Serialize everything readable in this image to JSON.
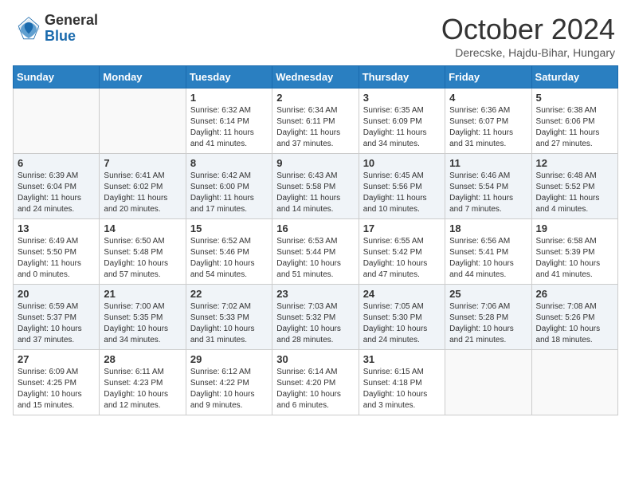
{
  "logo": {
    "general": "General",
    "blue": "Blue"
  },
  "header": {
    "month": "October 2024",
    "location": "Derecske, Hajdu-Bihar, Hungary"
  },
  "weekdays": [
    "Sunday",
    "Monday",
    "Tuesday",
    "Wednesday",
    "Thursday",
    "Friday",
    "Saturday"
  ],
  "weeks": [
    [
      {
        "day": "",
        "sunrise": "",
        "sunset": "",
        "daylight": ""
      },
      {
        "day": "",
        "sunrise": "",
        "sunset": "",
        "daylight": ""
      },
      {
        "day": "1",
        "sunrise": "Sunrise: 6:32 AM",
        "sunset": "Sunset: 6:14 PM",
        "daylight": "Daylight: 11 hours and 41 minutes."
      },
      {
        "day": "2",
        "sunrise": "Sunrise: 6:34 AM",
        "sunset": "Sunset: 6:11 PM",
        "daylight": "Daylight: 11 hours and 37 minutes."
      },
      {
        "day": "3",
        "sunrise": "Sunrise: 6:35 AM",
        "sunset": "Sunset: 6:09 PM",
        "daylight": "Daylight: 11 hours and 34 minutes."
      },
      {
        "day": "4",
        "sunrise": "Sunrise: 6:36 AM",
        "sunset": "Sunset: 6:07 PM",
        "daylight": "Daylight: 11 hours and 31 minutes."
      },
      {
        "day": "5",
        "sunrise": "Sunrise: 6:38 AM",
        "sunset": "Sunset: 6:06 PM",
        "daylight": "Daylight: 11 hours and 27 minutes."
      }
    ],
    [
      {
        "day": "6",
        "sunrise": "Sunrise: 6:39 AM",
        "sunset": "Sunset: 6:04 PM",
        "daylight": "Daylight: 11 hours and 24 minutes."
      },
      {
        "day": "7",
        "sunrise": "Sunrise: 6:41 AM",
        "sunset": "Sunset: 6:02 PM",
        "daylight": "Daylight: 11 hours and 20 minutes."
      },
      {
        "day": "8",
        "sunrise": "Sunrise: 6:42 AM",
        "sunset": "Sunset: 6:00 PM",
        "daylight": "Daylight: 11 hours and 17 minutes."
      },
      {
        "day": "9",
        "sunrise": "Sunrise: 6:43 AM",
        "sunset": "Sunset: 5:58 PM",
        "daylight": "Daylight: 11 hours and 14 minutes."
      },
      {
        "day": "10",
        "sunrise": "Sunrise: 6:45 AM",
        "sunset": "Sunset: 5:56 PM",
        "daylight": "Daylight: 11 hours and 10 minutes."
      },
      {
        "day": "11",
        "sunrise": "Sunrise: 6:46 AM",
        "sunset": "Sunset: 5:54 PM",
        "daylight": "Daylight: 11 hours and 7 minutes."
      },
      {
        "day": "12",
        "sunrise": "Sunrise: 6:48 AM",
        "sunset": "Sunset: 5:52 PM",
        "daylight": "Daylight: 11 hours and 4 minutes."
      }
    ],
    [
      {
        "day": "13",
        "sunrise": "Sunrise: 6:49 AM",
        "sunset": "Sunset: 5:50 PM",
        "daylight": "Daylight: 11 hours and 0 minutes."
      },
      {
        "day": "14",
        "sunrise": "Sunrise: 6:50 AM",
        "sunset": "Sunset: 5:48 PM",
        "daylight": "Daylight: 10 hours and 57 minutes."
      },
      {
        "day": "15",
        "sunrise": "Sunrise: 6:52 AM",
        "sunset": "Sunset: 5:46 PM",
        "daylight": "Daylight: 10 hours and 54 minutes."
      },
      {
        "day": "16",
        "sunrise": "Sunrise: 6:53 AM",
        "sunset": "Sunset: 5:44 PM",
        "daylight": "Daylight: 10 hours and 51 minutes."
      },
      {
        "day": "17",
        "sunrise": "Sunrise: 6:55 AM",
        "sunset": "Sunset: 5:42 PM",
        "daylight": "Daylight: 10 hours and 47 minutes."
      },
      {
        "day": "18",
        "sunrise": "Sunrise: 6:56 AM",
        "sunset": "Sunset: 5:41 PM",
        "daylight": "Daylight: 10 hours and 44 minutes."
      },
      {
        "day": "19",
        "sunrise": "Sunrise: 6:58 AM",
        "sunset": "Sunset: 5:39 PM",
        "daylight": "Daylight: 10 hours and 41 minutes."
      }
    ],
    [
      {
        "day": "20",
        "sunrise": "Sunrise: 6:59 AM",
        "sunset": "Sunset: 5:37 PM",
        "daylight": "Daylight: 10 hours and 37 minutes."
      },
      {
        "day": "21",
        "sunrise": "Sunrise: 7:00 AM",
        "sunset": "Sunset: 5:35 PM",
        "daylight": "Daylight: 10 hours and 34 minutes."
      },
      {
        "day": "22",
        "sunrise": "Sunrise: 7:02 AM",
        "sunset": "Sunset: 5:33 PM",
        "daylight": "Daylight: 10 hours and 31 minutes."
      },
      {
        "day": "23",
        "sunrise": "Sunrise: 7:03 AM",
        "sunset": "Sunset: 5:32 PM",
        "daylight": "Daylight: 10 hours and 28 minutes."
      },
      {
        "day": "24",
        "sunrise": "Sunrise: 7:05 AM",
        "sunset": "Sunset: 5:30 PM",
        "daylight": "Daylight: 10 hours and 24 minutes."
      },
      {
        "day": "25",
        "sunrise": "Sunrise: 7:06 AM",
        "sunset": "Sunset: 5:28 PM",
        "daylight": "Daylight: 10 hours and 21 minutes."
      },
      {
        "day": "26",
        "sunrise": "Sunrise: 7:08 AM",
        "sunset": "Sunset: 5:26 PM",
        "daylight": "Daylight: 10 hours and 18 minutes."
      }
    ],
    [
      {
        "day": "27",
        "sunrise": "Sunrise: 6:09 AM",
        "sunset": "Sunset: 4:25 PM",
        "daylight": "Daylight: 10 hours and 15 minutes."
      },
      {
        "day": "28",
        "sunrise": "Sunrise: 6:11 AM",
        "sunset": "Sunset: 4:23 PM",
        "daylight": "Daylight: 10 hours and 12 minutes."
      },
      {
        "day": "29",
        "sunrise": "Sunrise: 6:12 AM",
        "sunset": "Sunset: 4:22 PM",
        "daylight": "Daylight: 10 hours and 9 minutes."
      },
      {
        "day": "30",
        "sunrise": "Sunrise: 6:14 AM",
        "sunset": "Sunset: 4:20 PM",
        "daylight": "Daylight: 10 hours and 6 minutes."
      },
      {
        "day": "31",
        "sunrise": "Sunrise: 6:15 AM",
        "sunset": "Sunset: 4:18 PM",
        "daylight": "Daylight: 10 hours and 3 minutes."
      },
      {
        "day": "",
        "sunrise": "",
        "sunset": "",
        "daylight": ""
      },
      {
        "day": "",
        "sunrise": "",
        "sunset": "",
        "daylight": ""
      }
    ]
  ]
}
